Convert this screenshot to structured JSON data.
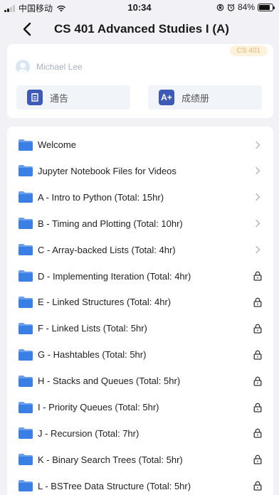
{
  "status_bar": {
    "carrier": "中国移动",
    "time": "10:34",
    "battery": "84%",
    "battery_level": 0.84
  },
  "nav": {
    "title": "CS 401 Advanced Studies I (A)"
  },
  "course": {
    "badge": "CS 401",
    "teacher": "Michael Lee",
    "buttons": [
      {
        "label": "通告",
        "icon": "notice-icon"
      },
      {
        "label": "成绩册",
        "icon_text": "A+",
        "icon": "gradebook-icon"
      }
    ]
  },
  "colors": {
    "folder": "#3a7fe6",
    "accent": "#3d5bb6",
    "badge_bg": "#fdf2dd",
    "badge_text": "#e8b46b"
  },
  "modules": [
    {
      "label": "Welcome",
      "locked": false
    },
    {
      "label": "Jupyter Notebook Files for Videos",
      "locked": false
    },
    {
      "label": "A - Intro to Python (Total: 15hr)",
      "locked": false
    },
    {
      "label": "B - Timing and Plotting (Total: 10hr)",
      "locked": false
    },
    {
      "label": "C - Array-backed Lists (Total: 4hr)",
      "locked": false
    },
    {
      "label": "D - Implementing Iteration (Total: 4hr)",
      "locked": true
    },
    {
      "label": "E - Linked Structures (Total: 4hr)",
      "locked": true
    },
    {
      "label": "F - Linked Lists (Total: 5hr)",
      "locked": true
    },
    {
      "label": "G - Hashtables (Total: 5hr)",
      "locked": true
    },
    {
      "label": "H - Stacks and Queues (Total: 5hr)",
      "locked": true
    },
    {
      "label": "I - Priority Queues (Total: 5hr)",
      "locked": true
    },
    {
      "label": "J - Recursion (Total: 7hr)",
      "locked": true
    },
    {
      "label": "K - Binary Search Trees (Total: 5hr)",
      "locked": true
    },
    {
      "label": "L - BSTree Data Structure (Total: 5hr)",
      "locked": true
    }
  ]
}
